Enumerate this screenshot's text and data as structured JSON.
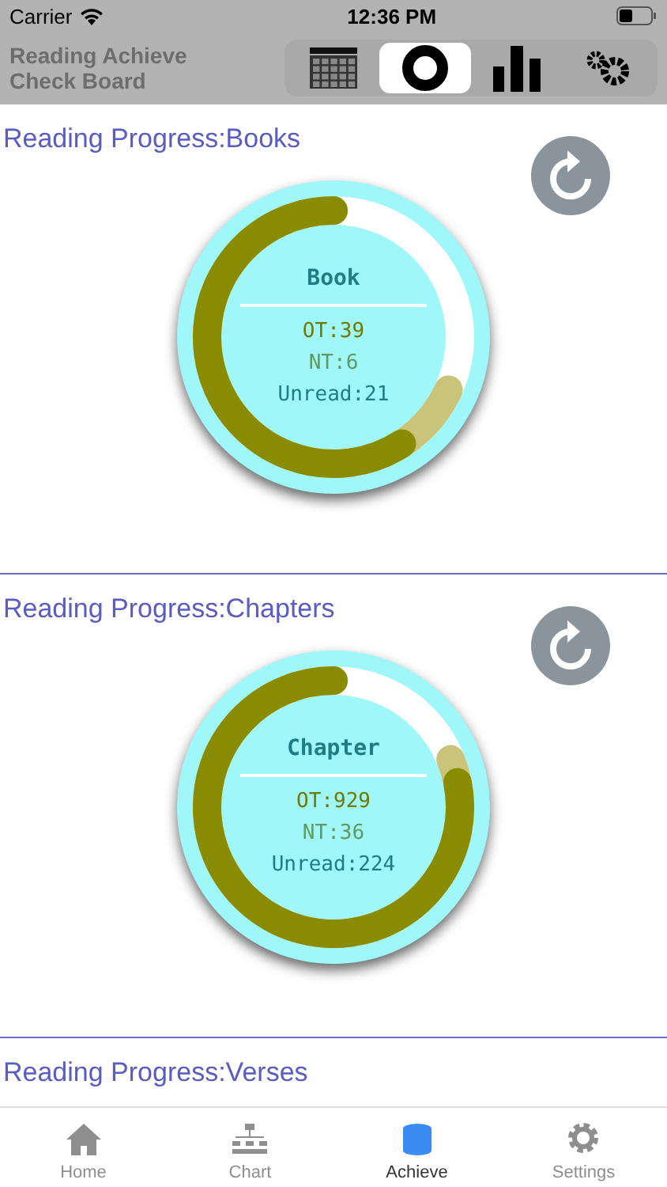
{
  "status_bar": {
    "carrier": "Carrier",
    "time": "12:36 PM"
  },
  "nav": {
    "title": "Reading Achieve Check Board",
    "segments": [
      {
        "kind": "calendar",
        "selected": false
      },
      {
        "kind": "ring",
        "selected": true
      },
      {
        "kind": "bars",
        "selected": false
      },
      {
        "kind": "gears",
        "selected": false
      }
    ]
  },
  "sections": [
    {
      "title": "Reading Progress:Books",
      "ring": {
        "heading": "Book",
        "lines": [
          {
            "kind": "ot",
            "text": "OT:39"
          },
          {
            "kind": "nt",
            "text": "NT:6"
          },
          {
            "kind": "unread",
            "text": "Unread:21"
          }
        ]
      }
    },
    {
      "title": "Reading Progress:Chapters",
      "ring": {
        "heading": "Chapter",
        "lines": [
          {
            "kind": "ot",
            "text": "OT:929"
          },
          {
            "kind": "nt",
            "text": "NT:36"
          },
          {
            "kind": "unread",
            "text": "Unread:224"
          }
        ]
      }
    },
    {
      "title": "Reading Progress:Verses"
    }
  ],
  "tab_bar": [
    {
      "kind": "home",
      "label": "Home",
      "selected": false
    },
    {
      "kind": "chart",
      "label": "Chart",
      "selected": false
    },
    {
      "kind": "achieve",
      "label": "Achieve",
      "selected": true
    },
    {
      "kind": "settings",
      "label": "Settings",
      "selected": false
    }
  ]
}
